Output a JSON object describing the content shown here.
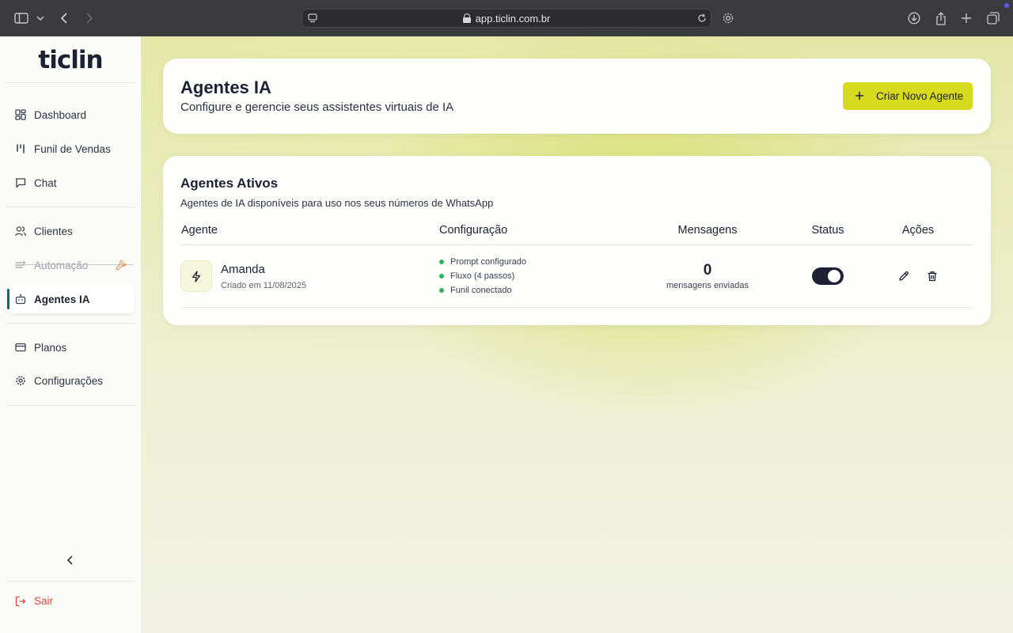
{
  "browser": {
    "url": "app.ticlin.com.br"
  },
  "sidebar": {
    "logo": "ticlin",
    "items": [
      {
        "label": "Dashboard"
      },
      {
        "label": "Funil de Vendas"
      },
      {
        "label": "Chat"
      },
      {
        "label": "Clientes"
      },
      {
        "label": "Automação"
      },
      {
        "label": "Agentes IA"
      },
      {
        "label": "Planos"
      },
      {
        "label": "Configurações"
      }
    ],
    "logout_label": "Sair"
  },
  "header": {
    "title": "Agentes IA",
    "subtitle": "Configure e gerencie seus assistentes virtuais de IA",
    "new_button_label": "Criar Novo Agente"
  },
  "agents_section": {
    "title": "Agentes Ativos",
    "subtitle": "Agentes de IA disponíveis para uso nos seus números de WhatsApp",
    "columns": [
      "Agente",
      "Configuração",
      "Mensagens",
      "Status",
      "Ações"
    ],
    "rows": [
      {
        "name": "Amanda",
        "created": "Criado em 11/08/2025",
        "config": [
          "Prompt configurado",
          "Fluxo (4 passos)",
          "Funil conectado"
        ],
        "messages": "0",
        "messages_label": "mensagens enviadas",
        "status_on": true
      }
    ]
  },
  "colors": {
    "accent": "#d8da1d",
    "active_indicator": "#0f6a63",
    "logout": "#e0453a",
    "config_dot": "#2fb35a"
  }
}
